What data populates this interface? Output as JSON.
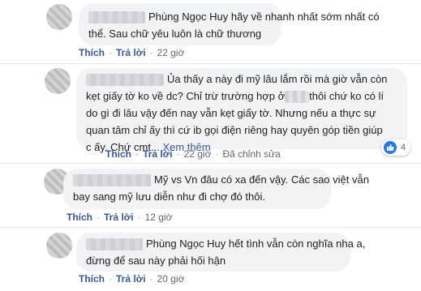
{
  "comments": [
    {
      "text": "Phùng Ngọc Huy hãy về nhanh nhất sớm nhất có thể. Sau chữ yêu luôn là chữ thương",
      "line1": "Phùng Ngọc Huy hãy về nhanh nhất sớm nhất có",
      "line2": "thể. Sau chữ yêu luôn là chữ thương",
      "actions": {
        "like": "Thích",
        "reply": "Trả lời",
        "time": "22 giờ"
      }
    },
    {
      "line1": "Ủa thấy a này đi mỹ lâu lắm rồi mà giờ vẫn còn",
      "line2": "kẹt giấy tờ ko về dc? Chỉ trừ trường hợp ở",
      "line2b": "thôi chứ ko có lí",
      "line3": "do gì đi lâu vậy đến nay vẫn kẹt giấy tờ. Nhưng nếu a thực sự",
      "line4": "quan tâm chỉ ấy thì cứ ib gọi điện riêng hay quyên góp tiền giúp",
      "line5": "c ấy. Chứ cmt...",
      "see_more": "Xem thêm",
      "actions": {
        "like": "Thích",
        "reply": "Trả lời",
        "time": "22 giờ",
        "edited": "Đã chỉnh sửa"
      },
      "reaction_count": "4"
    },
    {
      "line1": "Mỹ vs Vn đâu có xa đến vậy. Các sao việt vẫn",
      "line2": "bay sang mỹ lưu diễn như đi chợ đó thôi.",
      "actions": {
        "like": "Thích",
        "reply": "Trả lời",
        "time": "12 giờ"
      }
    },
    {
      "line1": "Phùng Ngọc Huy hết tình vẫn còn nghĩa nha a,",
      "line2": "đừng để sau này phải hối hận",
      "actions": {
        "like": "Thích",
        "reply": "Trả lời",
        "time": "20 giờ"
      }
    }
  ],
  "colors": {
    "bubble": "#f2f3f5",
    "link": "#385898",
    "meta": "#616770",
    "like": "#2078f4"
  }
}
